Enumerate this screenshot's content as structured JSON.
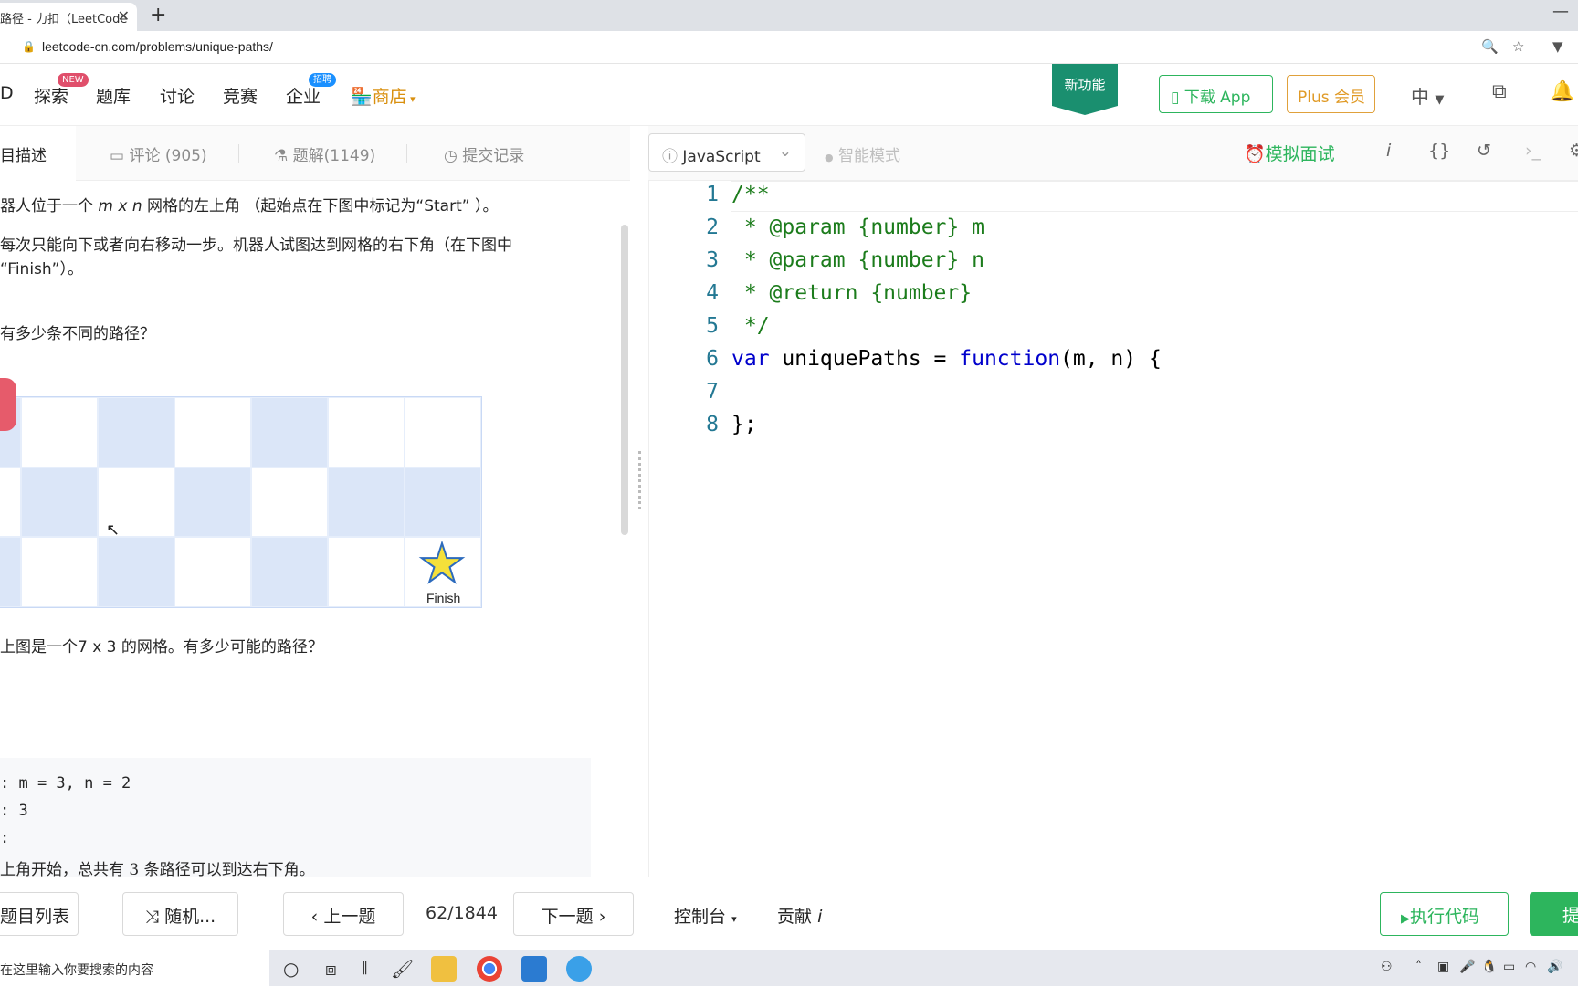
{
  "browser": {
    "tab_title": "路径 - 力扣（LeetCode",
    "tab_close": "✕",
    "new_tab": "+",
    "url": "leetcode-cn.com/problems/unique-paths/"
  },
  "nav": {
    "logo_fragment": "D",
    "items": [
      {
        "label": "探索",
        "badge": "NEW"
      },
      {
        "label": "题库"
      },
      {
        "label": "讨论"
      },
      {
        "label": "竞赛"
      },
      {
        "label": "企业",
        "badge": "招聘"
      }
    ],
    "shop_label": "商店",
    "new_feature": "新功能",
    "download_app": "下载 App",
    "plus": "Plus 会员",
    "language": "中"
  },
  "left_tabs": {
    "description": "目描述",
    "comments": "评论 (905)",
    "solutions": "题解(1149)",
    "submissions": "提交记录"
  },
  "problem": {
    "line1_a": "器人位于一个",
    "line1_math": "m x n",
    "line1_b": "网格的左上角 （起始点在下图中标记为“Start” ）。",
    "line2": "每次只能向下或者向右移动一步。机器人试图达到网格的右下角（在下图中",
    "line3": "“Finish”）。",
    "line4": "有多少条不同的路径？",
    "finish_label": "Finish",
    "caption": "上图是一个7 x 3 的网格。有多少可能的路径？",
    "example_lines": [
      ": m = 3, n = 2",
      ": 3",
      ":",
      "上角开始，总共有 3 条路径可以到达右下角。"
    ]
  },
  "editor": {
    "language": "JavaScript",
    "smart_mode": "智能模式",
    "mock_interview": "模拟面试",
    "line_numbers": [
      "1",
      "2",
      "3",
      "4",
      "5",
      "6",
      "7",
      "8"
    ]
  },
  "footer": {
    "problem_list": "题目列表",
    "random": "随机...",
    "prev": "上一题",
    "counter": "62/1844",
    "next": "下一题",
    "console": "控制台",
    "contribute": "贡献",
    "run": "执行代码",
    "submit": "提"
  },
  "taskbar": {
    "search_placeholder": "在这里输入你要搜索的内容"
  },
  "colors": {
    "accent_green": "#2db55d",
    "plus_orange": "#e09a26",
    "grid_blue": "#dbe6f8"
  }
}
